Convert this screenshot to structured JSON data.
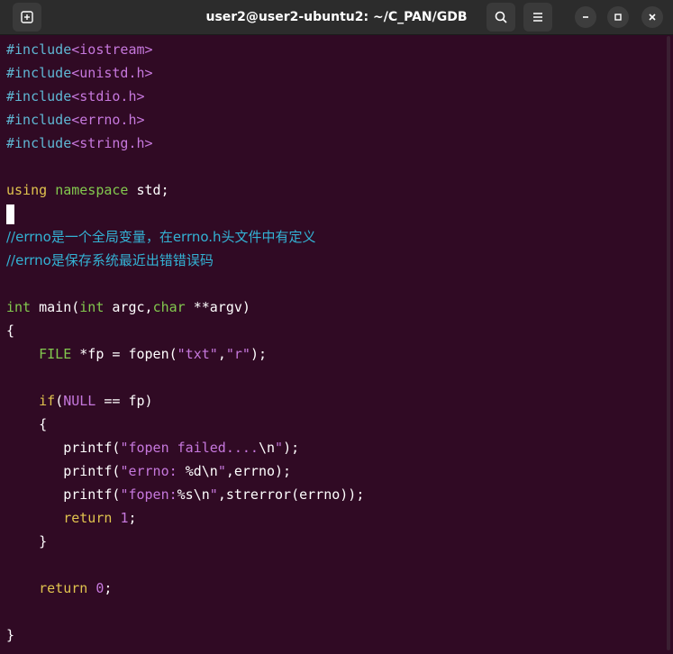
{
  "window": {
    "title": "user2@user2-ubuntu2: ~/C_PAN/GDB",
    "new_tab_icon": "new-tab-icon",
    "search_icon": "search-icon",
    "menu_icon": "hamburger-menu-icon",
    "minimize_icon": "minimize-icon",
    "maximize_icon": "maximize-icon",
    "close_icon": "close-icon"
  },
  "colors": {
    "background": "#300a24",
    "preprocessor": "#5fb7d4",
    "string": "#c678dd",
    "keyword": "#e0c34e",
    "type": "#82c84e",
    "comment": "#33b2d4"
  },
  "code": [
    [
      {
        "t": "#include",
        "c": "pre"
      },
      {
        "t": "<iostream>",
        "c": "str"
      }
    ],
    [
      {
        "t": "#include",
        "c": "pre"
      },
      {
        "t": "<unistd.h>",
        "c": "str"
      }
    ],
    [
      {
        "t": "#include",
        "c": "pre"
      },
      {
        "t": "<stdio.h>",
        "c": "str"
      }
    ],
    [
      {
        "t": "#include",
        "c": "pre"
      },
      {
        "t": "<errno.h>",
        "c": "str"
      }
    ],
    [
      {
        "t": "#include",
        "c": "pre"
      },
      {
        "t": "<string.h>",
        "c": "str"
      }
    ],
    [],
    [
      {
        "t": "using",
        "c": "kw"
      },
      {
        "t": " ",
        "c": "def"
      },
      {
        "t": "namespace",
        "c": "type"
      },
      {
        "t": " std;",
        "c": "def"
      }
    ],
    [
      {
        "t": "",
        "c": "cursor"
      }
    ],
    [
      {
        "t": "//errno是一个全局变量，在errno.h头文件中有定义",
        "c": "com"
      }
    ],
    [
      {
        "t": "//errno是保存系统最近出错错误码",
        "c": "com"
      }
    ],
    [],
    [
      {
        "t": "int",
        "c": "type"
      },
      {
        "t": " main(",
        "c": "def"
      },
      {
        "t": "int",
        "c": "type"
      },
      {
        "t": " argc,",
        "c": "def"
      },
      {
        "t": "char",
        "c": "type"
      },
      {
        "t": " **argv)",
        "c": "def"
      }
    ],
    [
      {
        "t": "{",
        "c": "def"
      }
    ],
    [
      {
        "t": "    ",
        "c": "def"
      },
      {
        "t": "FILE",
        "c": "type"
      },
      {
        "t": " *fp = fopen(",
        "c": "def"
      },
      {
        "t": "\"txt\"",
        "c": "str"
      },
      {
        "t": ",",
        "c": "def"
      },
      {
        "t": "\"r\"",
        "c": "str"
      },
      {
        "t": ");",
        "c": "def"
      }
    ],
    [],
    [
      {
        "t": "    ",
        "c": "def"
      },
      {
        "t": "if",
        "c": "kw"
      },
      {
        "t": "(",
        "c": "def"
      },
      {
        "t": "NULL",
        "c": "str"
      },
      {
        "t": " == fp)",
        "c": "def"
      }
    ],
    [
      {
        "t": "    {",
        "c": "def"
      }
    ],
    [
      {
        "t": "       printf(",
        "c": "def"
      },
      {
        "t": "\"fopen failed....",
        "c": "str"
      },
      {
        "t": "\\n",
        "c": "def"
      },
      {
        "t": "\"",
        "c": "str"
      },
      {
        "t": ");",
        "c": "def"
      }
    ],
    [
      {
        "t": "       printf(",
        "c": "def"
      },
      {
        "t": "\"errno: ",
        "c": "str"
      },
      {
        "t": "%d\\n",
        "c": "def"
      },
      {
        "t": "\"",
        "c": "str"
      },
      {
        "t": ",errno);",
        "c": "def"
      }
    ],
    [
      {
        "t": "       printf(",
        "c": "def"
      },
      {
        "t": "\"fopen:",
        "c": "str"
      },
      {
        "t": "%s\\n",
        "c": "def"
      },
      {
        "t": "\"",
        "c": "str"
      },
      {
        "t": ",strerror(errno));",
        "c": "def"
      }
    ],
    [
      {
        "t": "       ",
        "c": "def"
      },
      {
        "t": "return",
        "c": "kw"
      },
      {
        "t": " ",
        "c": "def"
      },
      {
        "t": "1",
        "c": "num"
      },
      {
        "t": ";",
        "c": "def"
      }
    ],
    [
      {
        "t": "    }",
        "c": "def"
      }
    ],
    [],
    [
      {
        "t": "    ",
        "c": "def"
      },
      {
        "t": "return",
        "c": "kw"
      },
      {
        "t": " ",
        "c": "def"
      },
      {
        "t": "0",
        "c": "num"
      },
      {
        "t": ";",
        "c": "def"
      }
    ],
    [],
    [
      {
        "t": "}",
        "c": "def"
      }
    ]
  ]
}
